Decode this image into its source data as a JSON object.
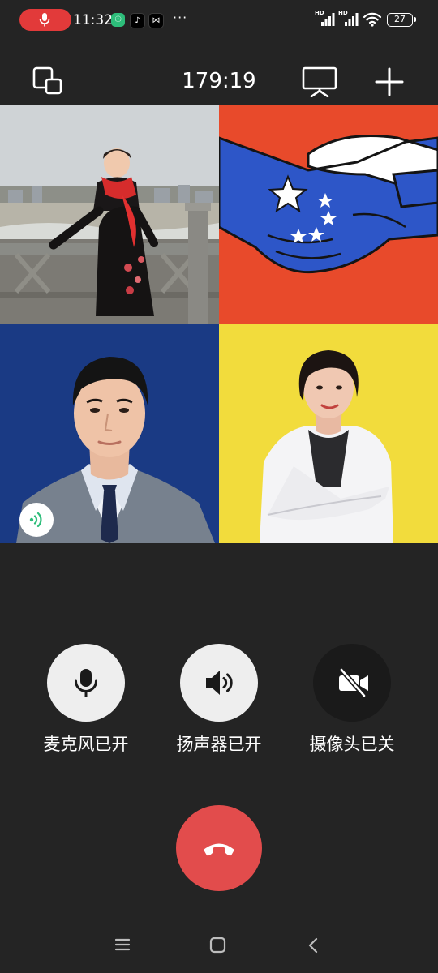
{
  "status_bar": {
    "time": "11:32",
    "battery": "27",
    "more": "···",
    "network_tag": "HD",
    "icons": [
      "mic-recording-icon",
      "security-app-icon",
      "tiktok-app-icon",
      "capcut-app-icon",
      "more-icon",
      "hd-signal-icon",
      "wifi-icon",
      "battery-icon"
    ]
  },
  "call": {
    "duration": "179:19",
    "header_icons": [
      "switch-window-icon",
      "screen-share-icon",
      "add-participant-icon"
    ]
  },
  "participants": [
    {
      "tile": "participant-1",
      "speaking": false
    },
    {
      "tile": "participant-2",
      "speaking": false
    },
    {
      "tile": "participant-3",
      "speaking": true
    },
    {
      "tile": "participant-4",
      "speaking": false
    }
  ],
  "controls": {
    "mic": {
      "label": "麦克风已开",
      "state": "on",
      "icon": "microphone-icon"
    },
    "speaker": {
      "label": "扬声器已开",
      "state": "on",
      "icon": "speaker-icon"
    },
    "camera": {
      "label": "摄像头已关",
      "state": "off",
      "icon": "camera-off-icon"
    }
  },
  "hangup": {
    "icon": "hang-up-icon",
    "color": "#e24c4c"
  },
  "nav_bar": {
    "icons": [
      "menu-icon",
      "home-icon",
      "back-icon"
    ]
  },
  "colors": {
    "background": "#242424",
    "control_on": "#eeeeee",
    "control_off": "#1a1a1a",
    "recording": "#e23a3a",
    "speaking": "#2dbd7a"
  }
}
